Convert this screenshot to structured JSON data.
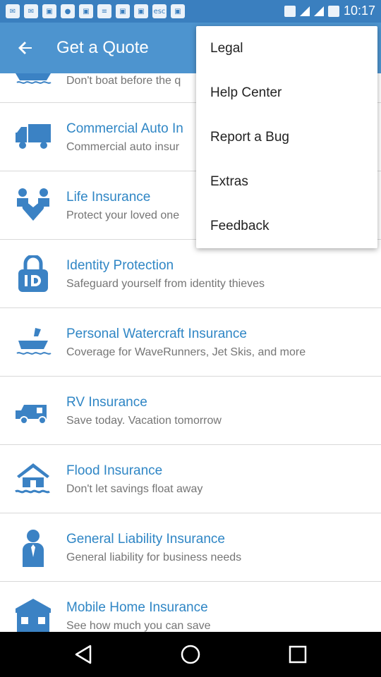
{
  "status_bar": {
    "time": "10:17",
    "notification_icons": [
      "mail-icon",
      "mail-icon",
      "photo-icon",
      "chat-icon",
      "photo-icon",
      "notes-icon",
      "photo-icon",
      "photo-icon",
      "esc-icon",
      "photo-icon"
    ],
    "esc_label": "esc"
  },
  "app_bar": {
    "title": "Get a Quote",
    "back_icon": "arrow-left-icon"
  },
  "list": {
    "items": [
      {
        "title": "",
        "subtitle": "Don't boat before the q",
        "icon": "boat-icon"
      },
      {
        "title": "Commercial Auto In",
        "subtitle": "Commercial auto insur",
        "icon": "truck-icon"
      },
      {
        "title": "Life Insurance",
        "subtitle": "Protect your loved one",
        "icon": "family-heart-icon"
      },
      {
        "title": "Identity Protection",
        "subtitle": "Safeguard yourself from identity thieves",
        "icon": "id-lock-icon"
      },
      {
        "title": "Personal Watercraft Insurance",
        "subtitle": "Coverage for WaveRunners, Jet Skis, and more",
        "icon": "jetski-icon"
      },
      {
        "title": "RV Insurance",
        "subtitle": "Save today. Vacation tomorrow",
        "icon": "rv-icon"
      },
      {
        "title": "Flood Insurance",
        "subtitle": "Don't let savings float away",
        "icon": "flood-house-icon"
      },
      {
        "title": "General Liability Insurance",
        "subtitle": "General liability for business needs",
        "icon": "person-icon"
      },
      {
        "title": "Mobile Home Insurance",
        "subtitle": "See how much you can save",
        "icon": "mobile-home-icon"
      }
    ]
  },
  "menu": {
    "items": [
      {
        "label": "Legal"
      },
      {
        "label": "Help Center"
      },
      {
        "label": "Report a Bug"
      },
      {
        "label": "Extras"
      },
      {
        "label": "Feedback"
      }
    ]
  },
  "nav_bar": {
    "back_icon": "nav-back-icon",
    "home_icon": "nav-home-icon",
    "recents_icon": "nav-recents-icon"
  },
  "colors": {
    "status_bar": "#3a7fbf",
    "app_bar": "#4d94cf",
    "accent_text": "#2f86c5",
    "icon_blue": "#3b82c4",
    "subtitle": "#757575"
  }
}
